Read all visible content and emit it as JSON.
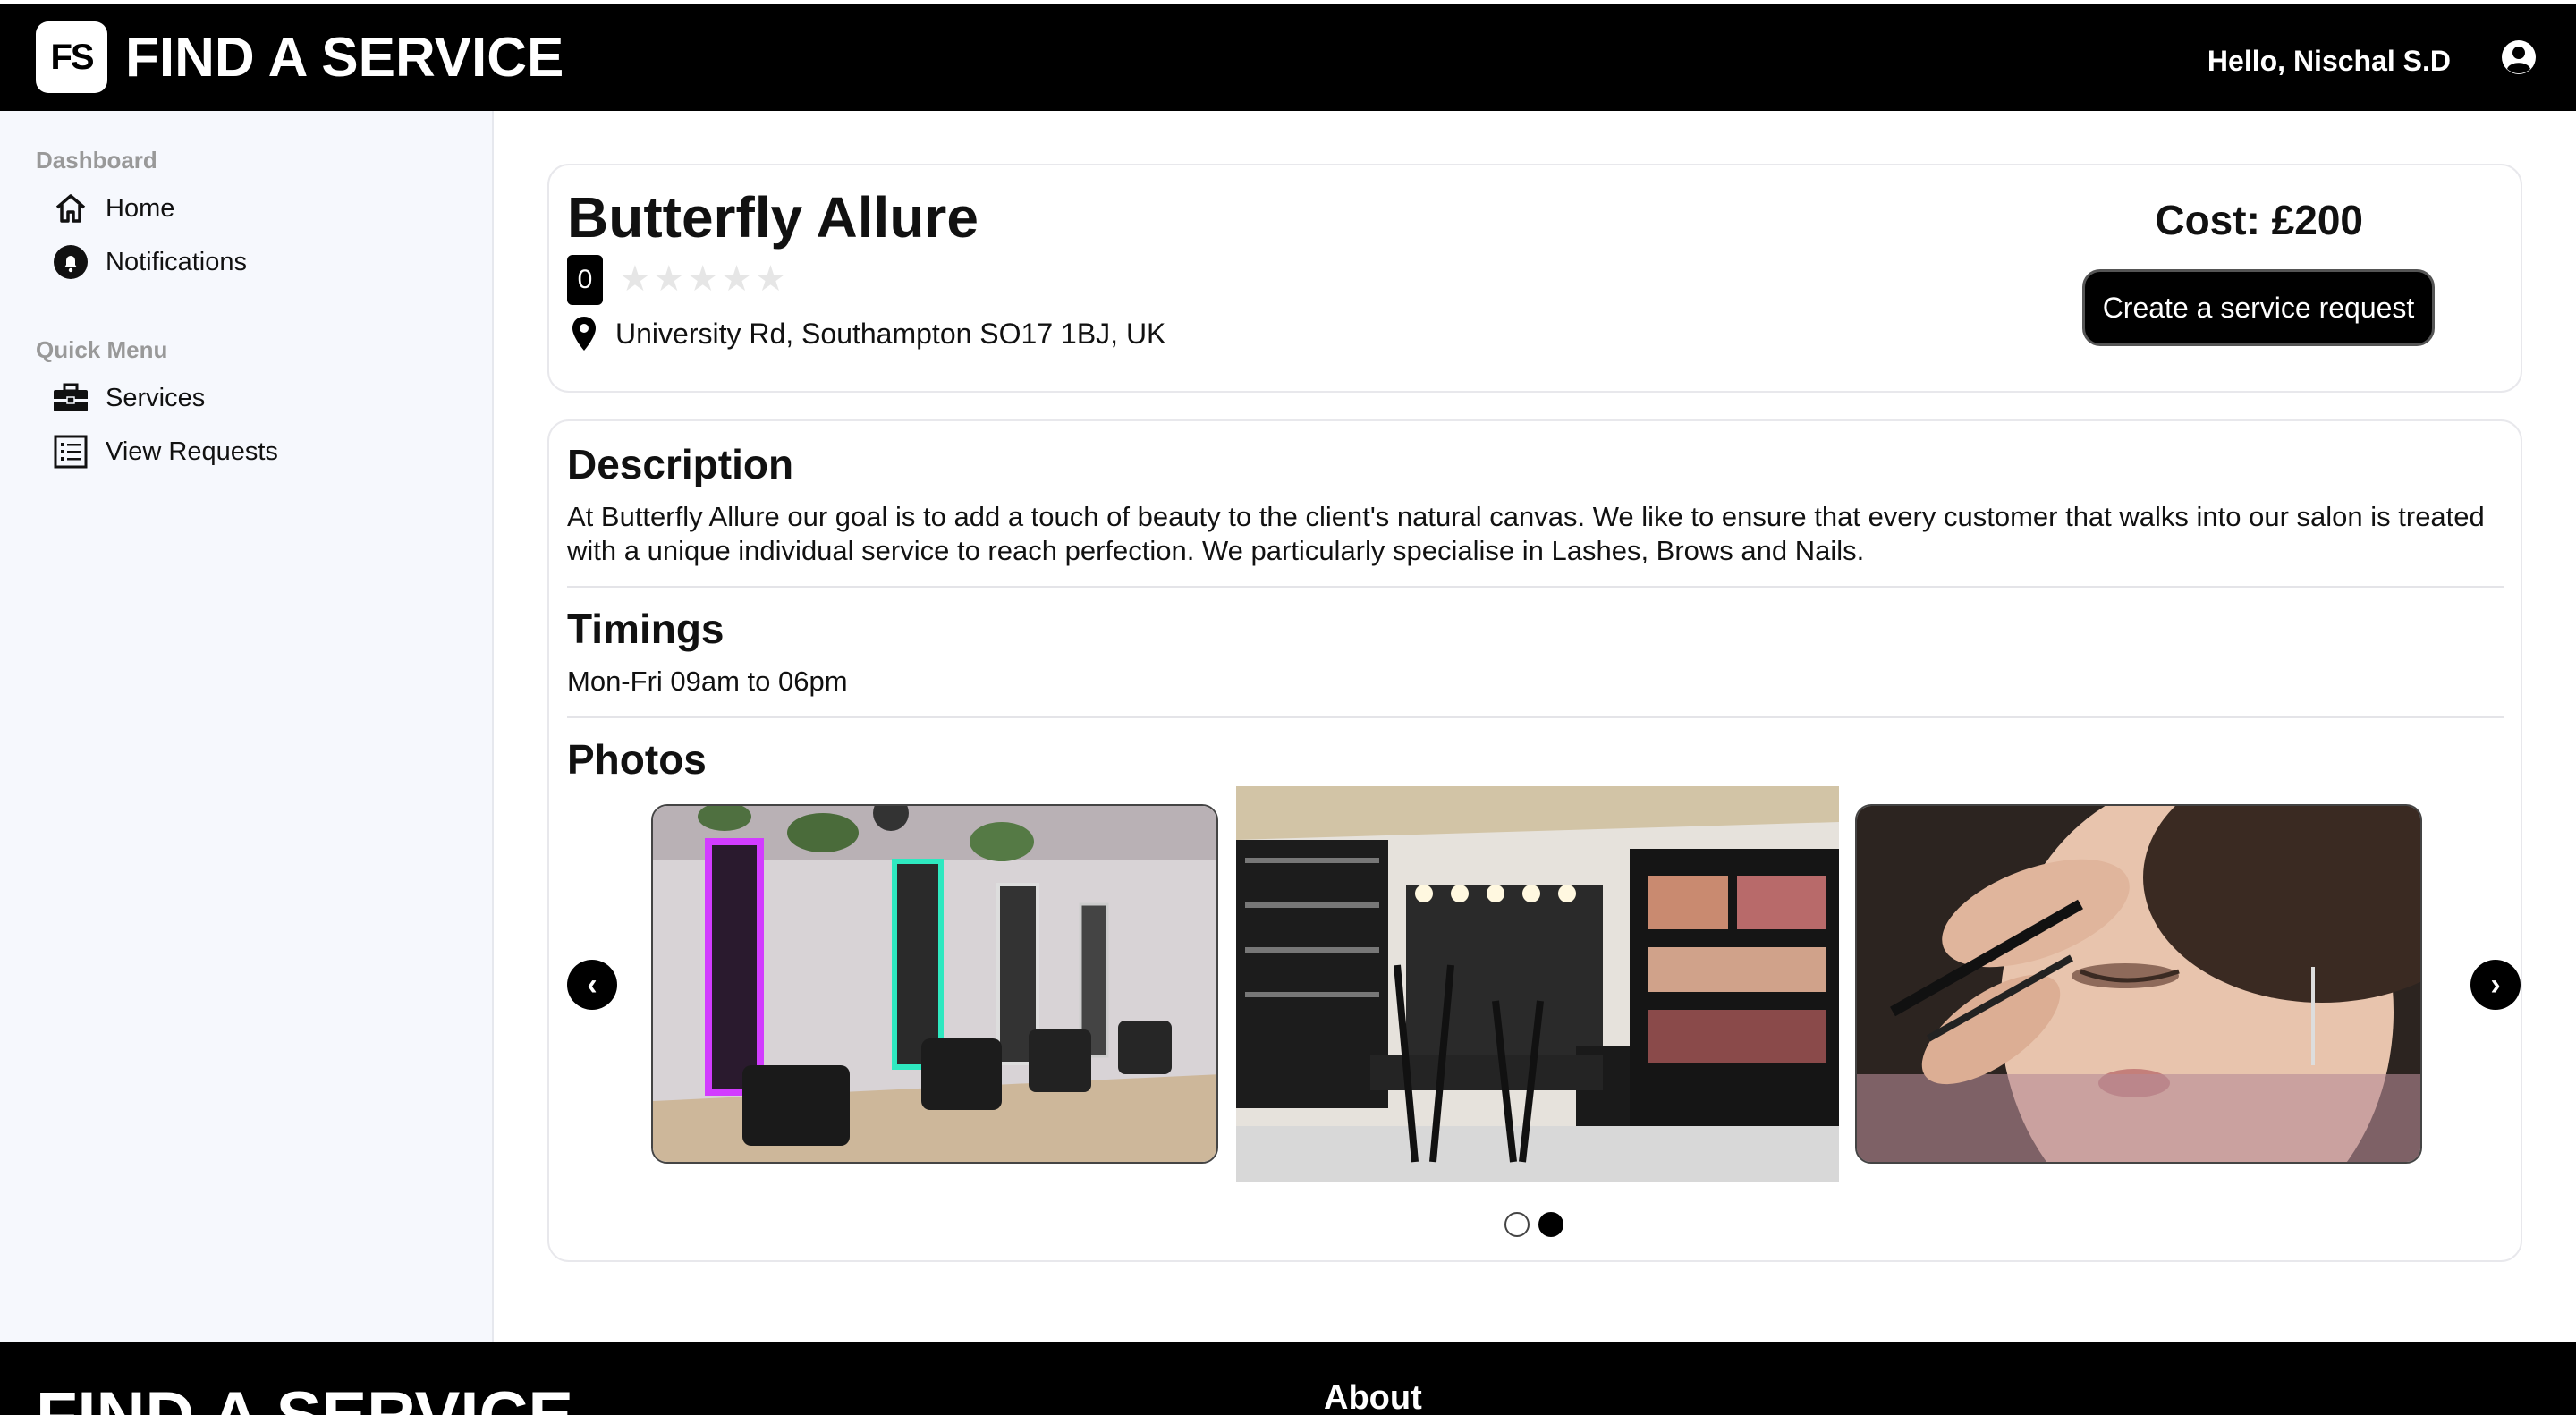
{
  "header": {
    "logo_text": "FS",
    "brand": "FIND A SERVICE",
    "greeting": "Hello, Nischal S.D",
    "user_icon": "user-circle-icon"
  },
  "sidebar": {
    "sections": [
      {
        "heading": "Dashboard",
        "items": [
          {
            "label": "Home",
            "icon": "home-icon"
          },
          {
            "label": "Notifications",
            "icon": "bell-icon"
          }
        ]
      },
      {
        "heading": "Quick Menu",
        "items": [
          {
            "label": "Services",
            "icon": "briefcase-icon"
          },
          {
            "label": "View Requests",
            "icon": "list-icon"
          }
        ]
      }
    ]
  },
  "service": {
    "name": "Butterfly Allure",
    "rating_count": "0",
    "rating_stars": 0,
    "rating_stars_text": "★★★★★",
    "address": "University Rd, Southampton SO17 1BJ, UK",
    "cost": "Cost: £200",
    "request_button": "Create a service request"
  },
  "details": {
    "description_title": "Description",
    "description_text": "At Butterfly Allure our goal is to add a touch of beauty to the client's natural canvas. We like to ensure that every customer that walks into our salon is treated with a unique individual service to reach perfection. We particularly specialise in Lashes, Brows and Nails.",
    "timings_title": "Timings",
    "timings_text": "Mon-Fri 09am to 06pm",
    "photos_title": "Photos"
  },
  "carousel": {
    "prev": "‹",
    "next": "›",
    "photos": [
      "Salon interior with neon-lit mirrors",
      "Makeup studio with product shelves",
      "Makeup artist applying eyeshadow"
    ],
    "active_dot": 2,
    "dot_count": 2
  },
  "footer": {
    "brand": "FIND A SERVICE",
    "about": "About"
  },
  "colors": {
    "header_bg": "#000000",
    "sidebar_bg": "#f6f8fd",
    "accent": "#000000"
  }
}
